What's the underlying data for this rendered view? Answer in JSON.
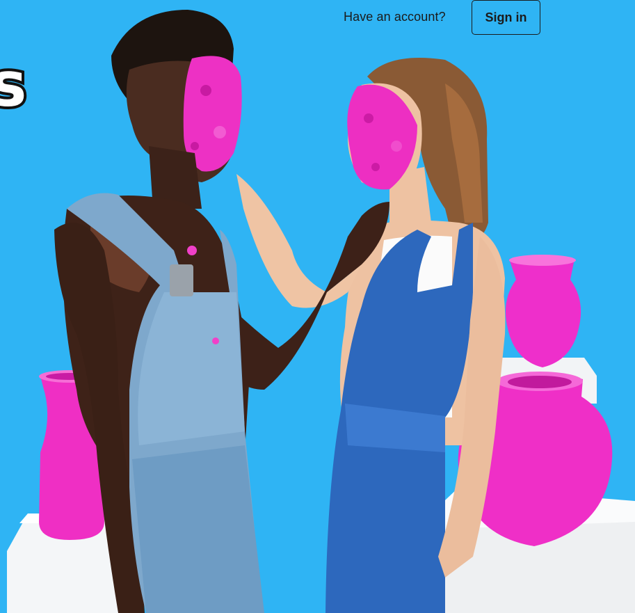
{
  "header": {
    "account_prompt": "Have an account?",
    "signin_label": "Sign in"
  },
  "logo": {
    "visible_fragment": "s"
  },
  "colors": {
    "background": "#2fb4f4",
    "accent_pink": "#ec2fc6",
    "pedestal": "#f4f6f8",
    "text": "#1b1b1b"
  }
}
